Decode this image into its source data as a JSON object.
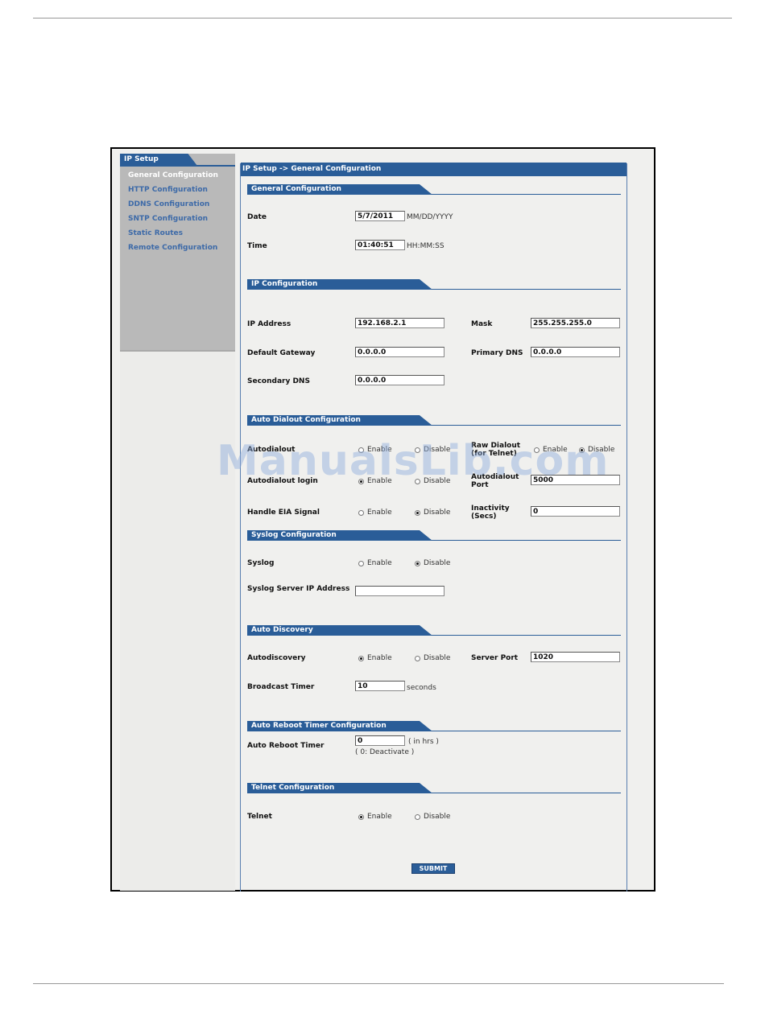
{
  "watermark": "ManualsLib.com",
  "sidebar": {
    "tab": "IP Setup",
    "items": [
      {
        "label": "General Configuration",
        "active": true
      },
      {
        "label": "HTTP Configuration"
      },
      {
        "label": "DDNS Configuration"
      },
      {
        "label": "SNTP Configuration"
      },
      {
        "label": "Static Routes"
      },
      {
        "label": "Remote Configuration"
      }
    ]
  },
  "header": {
    "breadcrumb": "IP Setup  ->  General Configuration"
  },
  "general": {
    "title": "General Configuration",
    "date_label": "Date",
    "date_value": "5/7/2011",
    "date_format": "MM/DD/YYYY",
    "time_label": "Time",
    "time_value": "01:40:51",
    "time_format": "HH:MM:SS"
  },
  "ip": {
    "title": "IP Configuration",
    "ip_label": "IP Address",
    "ip_value": "192.168.2.1",
    "mask_label": "Mask",
    "mask_value": "255.255.255.0",
    "gw_label": "Default Gateway",
    "gw_value": "0.0.0.0",
    "pdns_label": "Primary DNS",
    "pdns_value": "0.0.0.0",
    "sdns_label": "Secondary DNS",
    "sdns_value": "0.0.0.0"
  },
  "dialout": {
    "title": "Auto Dialout Configuration",
    "autodialout_label": "Autodialout",
    "raw_label": "Raw Dialout (for Telnet)",
    "login_label": "Autodialout login",
    "port_label": "Autodialout Port",
    "port_value": "5000",
    "eia_label": "Handle EIA Signal",
    "inactivity_label": "Inactivity (Secs)",
    "inactivity_value": "0"
  },
  "syslog": {
    "title": "Syslog Configuration",
    "syslog_label": "Syslog",
    "server_label": "Syslog Server IP Address",
    "server_value": ""
  },
  "discovery": {
    "title": "Auto Discovery",
    "auto_label": "Autodiscovery",
    "port_label": "Server Port",
    "port_value": "1020",
    "timer_label": "Broadcast Timer",
    "timer_value": "10",
    "timer_unit": "seconds"
  },
  "reboot": {
    "title": "Auto Reboot Timer Configuration",
    "timer_label": "Auto Reboot Timer",
    "timer_value": "0",
    "unit": "( in hrs )",
    "note": "( 0: Deactivate )"
  },
  "telnet": {
    "title": "Telnet Configuration",
    "label": "Telnet"
  },
  "options": {
    "enable": "Enable",
    "disable": "Disable"
  },
  "submit_label": "SUBMIT"
}
